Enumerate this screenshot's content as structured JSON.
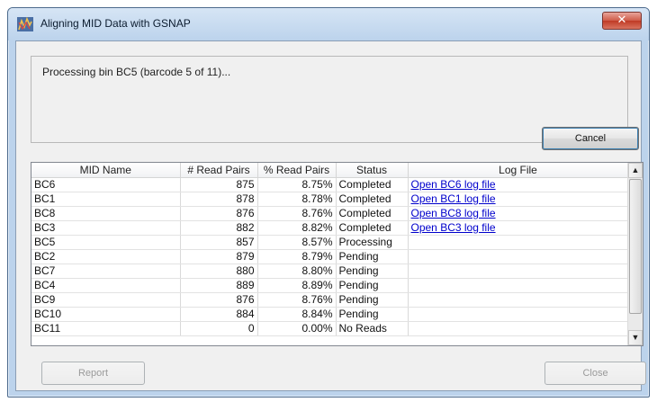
{
  "window": {
    "title": "Aligning MID Data with GSNAP",
    "close_glyph": "✕"
  },
  "status": {
    "message": "Processing bin BC5 (barcode 5 of 11)..."
  },
  "buttons": {
    "cancel": "Cancel",
    "report": "Report",
    "close": "Close"
  },
  "table": {
    "headers": [
      "MID Name",
      "# Read Pairs",
      "% Read Pairs",
      "Status",
      "Log File"
    ],
    "rows": [
      {
        "mid": "BC6",
        "pairs": "875",
        "pct": "8.75%",
        "status": "Completed",
        "log": "Open BC6 log file"
      },
      {
        "mid": "BC1",
        "pairs": "878",
        "pct": "8.78%",
        "status": "Completed",
        "log": "Open BC1 log file"
      },
      {
        "mid": "BC8",
        "pairs": "876",
        "pct": "8.76%",
        "status": "Completed",
        "log": "Open BC8 log file"
      },
      {
        "mid": "BC3",
        "pairs": "882",
        "pct": "8.82%",
        "status": "Completed",
        "log": "Open BC3 log file"
      },
      {
        "mid": "BC5",
        "pairs": "857",
        "pct": "8.57%",
        "status": "Processing",
        "log": ""
      },
      {
        "mid": "BC2",
        "pairs": "879",
        "pct": "8.79%",
        "status": "Pending",
        "log": ""
      },
      {
        "mid": "BC7",
        "pairs": "880",
        "pct": "8.80%",
        "status": "Pending",
        "log": ""
      },
      {
        "mid": "BC4",
        "pairs": "889",
        "pct": "8.89%",
        "status": "Pending",
        "log": ""
      },
      {
        "mid": "BC9",
        "pairs": "876",
        "pct": "8.76%",
        "status": "Pending",
        "log": ""
      },
      {
        "mid": "BC10",
        "pairs": "884",
        "pct": "8.84%",
        "status": "Pending",
        "log": ""
      },
      {
        "mid": "BC11",
        "pairs": "0",
        "pct": "0.00%",
        "status": "No Reads",
        "log": ""
      }
    ]
  },
  "scrollbar": {
    "up_glyph": "▲",
    "down_glyph": "▼"
  },
  "icons": {
    "app": "dna-chart-icon",
    "close": "close-icon",
    "scroll_up": "arrow-up-icon",
    "scroll_down": "arrow-down-icon"
  },
  "colors": {
    "link": "#0000cc",
    "close_button": "#cf5b48",
    "window_frame": "#bcd3ec"
  }
}
